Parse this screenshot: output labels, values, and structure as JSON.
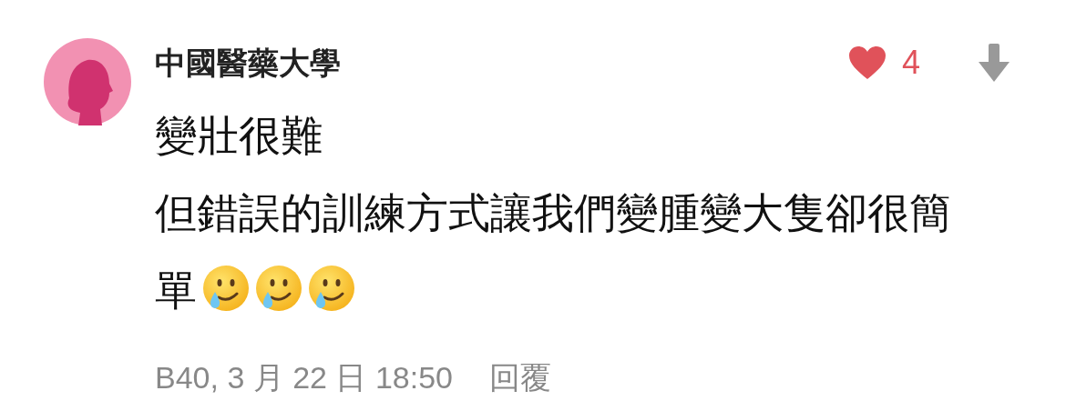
{
  "comment": {
    "author": "中國醫藥大學",
    "liked": true,
    "likes": "4",
    "lines": [
      "變壯很難",
      "但錯誤的訓練方式讓我們變腫變大隻卻很簡",
      "單"
    ],
    "emojis": [
      {
        "kind": "smile-tear"
      },
      {
        "kind": "smile-tear"
      },
      {
        "kind": "smile-tear"
      }
    ],
    "meta": "B40, 3 月 22 日 18:50",
    "reply": "回覆"
  }
}
